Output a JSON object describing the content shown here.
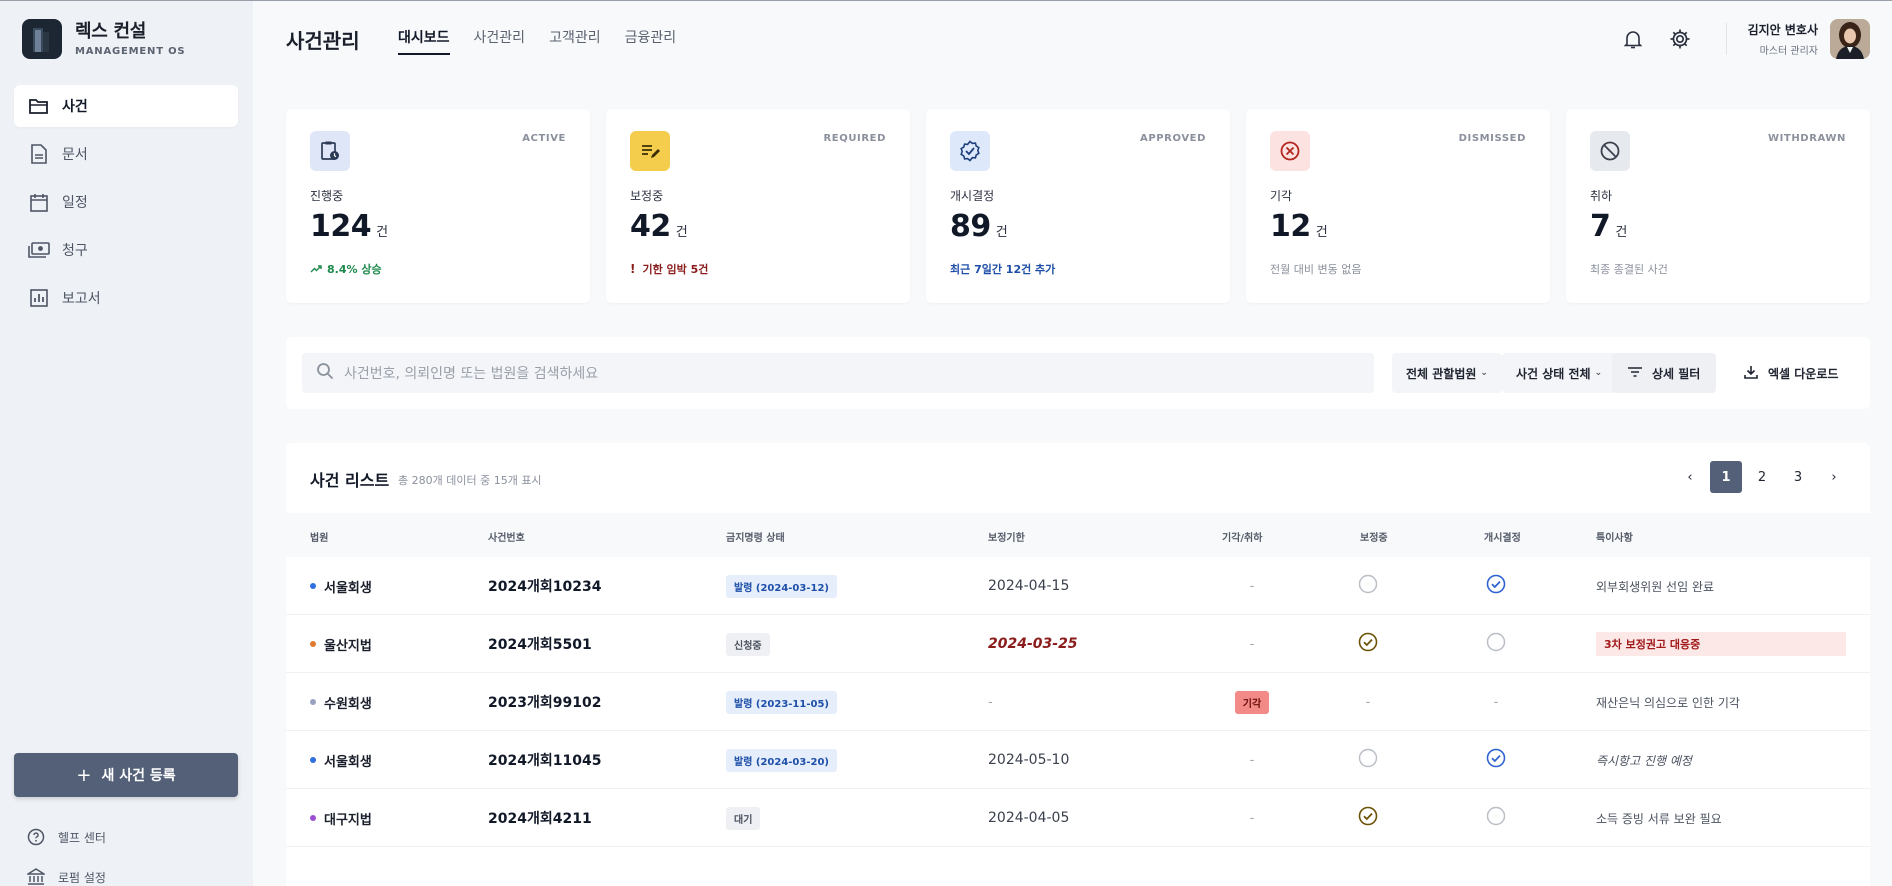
{
  "sidebar": {
    "brand_name": "렉스 컨설",
    "brand_sub": "MANAGEMENT OS",
    "items": [
      {
        "label": "사건",
        "icon": "folder-icon"
      },
      {
        "label": "문서",
        "icon": "document-icon"
      },
      {
        "label": "일정",
        "icon": "calendar-icon"
      },
      {
        "label": "청구",
        "icon": "payments-icon"
      },
      {
        "label": "보고서",
        "icon": "report-icon"
      }
    ],
    "new_case_label": "새 사건 등록",
    "help_label": "헬프 센터",
    "firm_settings_label": "로펌 설정"
  },
  "header": {
    "title": "사건관리",
    "tabs": [
      "대시보드",
      "사건관리",
      "고객관리",
      "금융관리"
    ],
    "active_tab": "대시보드",
    "user_name": "김지안 변호사",
    "user_role": "마스터 관리자"
  },
  "stats": [
    {
      "tag": "ACTIVE",
      "label": "진행중",
      "value": "124",
      "unit": "건",
      "note": "8.4% 상승",
      "note_color": "#1e8a4c",
      "icon": "clipboard-clock-icon",
      "icon_bg": "#dfe6f7"
    },
    {
      "tag": "REQUIRED",
      "label": "보정중",
      "value": "42",
      "unit": "건",
      "note": "기한 임박 5건",
      "note_color": "#8b1c1c",
      "icon": "edit-note-icon",
      "icon_bg": "#f5cd4d"
    },
    {
      "tag": "APPROVED",
      "label": "개시결정",
      "value": "89",
      "unit": "건",
      "note": "최근 7일간 12건 추가",
      "note_color": "#1e4fa8",
      "icon": "verified-badge-icon",
      "icon_bg": "#dde8fb"
    },
    {
      "tag": "DISMISSED",
      "label": "기각",
      "value": "12",
      "unit": "건",
      "note": "전월 대비 변동 없음",
      "note_color": "#8a909c",
      "icon": "x-circle-icon",
      "icon_bg": "#fde2e2"
    },
    {
      "tag": "WITHDRAWN",
      "label": "취하",
      "value": "7",
      "unit": "건",
      "note": "최종 종결된 사건",
      "note_color": "#8a909c",
      "icon": "block-icon",
      "icon_bg": "#e6e9ee"
    }
  ],
  "toolbar": {
    "search_placeholder": "사건번호, 의뢰인명 또는 법원을 검색하세요",
    "court_filter": "전체 관할법원",
    "status_filter": "사건 상태 전체",
    "detail_filter": "상세 필터",
    "excel_download": "엑셀 다운로드"
  },
  "table": {
    "title": "사건 리스트",
    "subtitle": "총 280개 데이터 중 15개 표시",
    "pages": [
      "1",
      "2",
      "3"
    ],
    "current_page": "1",
    "columns": [
      "법원",
      "사건번호",
      "금지명령 상태",
      "보정기한",
      "기각/취하",
      "보정중",
      "개시결정",
      "특이사항"
    ],
    "rows": [
      {
        "court": "서울회생",
        "dot": "#2f6fe0",
        "case_no": "2024개회10234",
        "ban_status": "발령 (2024-03-12)",
        "ban_style": "blue",
        "deadline": "2024-04-15",
        "deadline_style": "normal",
        "dismiss": "-",
        "dismiss_style": "dash",
        "correcting": "empty",
        "approved": "check-blue",
        "note": "외부회생위원 선임 완료",
        "note_style": "normal"
      },
      {
        "court": "울산지법",
        "dot": "#e07a2f",
        "case_no": "2024개회5501",
        "ban_status": "신청중",
        "ban_style": "gray",
        "deadline": "2024-03-25",
        "deadline_style": "urgent",
        "dismiss": "-",
        "dismiss_style": "dash",
        "correcting": "check-gold",
        "approved": "empty",
        "note": "3차 보정권고 대응중",
        "note_style": "red"
      },
      {
        "court": "수원회생",
        "dot": "#9aa0c0",
        "case_no": "2023개회99102",
        "ban_status": "발령 (2023-11-05)",
        "ban_style": "blue",
        "deadline": "-",
        "deadline_style": "dash",
        "dismiss": "기각",
        "dismiss_style": "red",
        "correcting": "dash",
        "approved": "dash",
        "note": "재산은닉 의심으로 인한 기각",
        "note_style": "normal"
      },
      {
        "court": "서울회생",
        "dot": "#2f6fe0",
        "case_no": "2024개회11045",
        "ban_status": "발령 (2024-03-20)",
        "ban_style": "blue",
        "deadline": "2024-05-10",
        "deadline_style": "normal",
        "dismiss": "-",
        "dismiss_style": "dash",
        "correcting": "empty",
        "approved": "check-blue",
        "note": "즉시항고 진행 예정",
        "note_style": "italic"
      },
      {
        "court": "대구지법",
        "dot": "#9b4fd0",
        "case_no": "2024개회4211",
        "ban_status": "대기",
        "ban_style": "gray",
        "deadline": "2024-04-05",
        "deadline_style": "normal",
        "dismiss": "-",
        "dismiss_style": "dash",
        "correcting": "check-gold",
        "approved": "empty",
        "note": "소득 증빙 서류 보완 필요",
        "note_style": "normal"
      }
    ]
  }
}
